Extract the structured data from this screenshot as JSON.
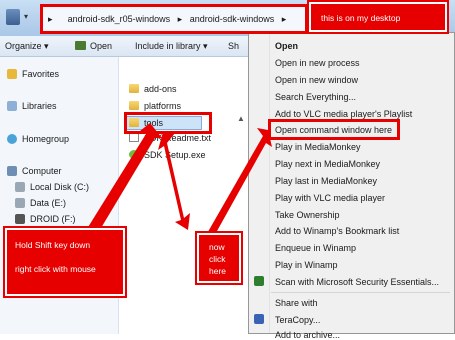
{
  "address": {
    "crumbs": [
      "android-sdk_r05-windows",
      "android-sdk-windows"
    ]
  },
  "toolbar": {
    "organize": "Organize ▾",
    "open": "Open",
    "include": "Include in library ▾",
    "share": "Sh"
  },
  "sidebar": {
    "favorites": "Favorites",
    "libraries": "Libraries",
    "homegroup": "Homegroup",
    "computer": "Computer",
    "local_disk": "Local Disk (C:)",
    "data": "Data (E:)",
    "droid": "DROID (F:)"
  },
  "files": [
    "add-ons",
    "platforms",
    "tools",
    "SDK Readme.txt",
    "SDK Setup.exe"
  ],
  "context_menu": {
    "items": [
      "Open",
      "Open in new process",
      "Open in new window",
      "Search Everything...",
      "Add to VLC media player's Playlist",
      "Open command window here",
      "Play in MediaMonkey",
      "Play next in MediaMonkey",
      "Play last in MediaMonkey",
      "Play with VLC media player",
      "Take Ownership",
      "Add to Winamp's Bookmark list",
      "Enqueue in Winamp",
      "Play in Winamp",
      "Scan with Microsoft Security Essentials...",
      "Share with",
      "TeraCopy...",
      "Add to archive..."
    ]
  },
  "annotations": {
    "desktop": "this is on my desktop",
    "shift_line1": "Hold Shift key down",
    "shift_line2": "right click with mouse",
    "now_line1": "now",
    "now_line2": "click",
    "now_line3": "here"
  },
  "colors": {
    "annotation_red": "#e60000",
    "selection_blue": "#cde3f8"
  }
}
